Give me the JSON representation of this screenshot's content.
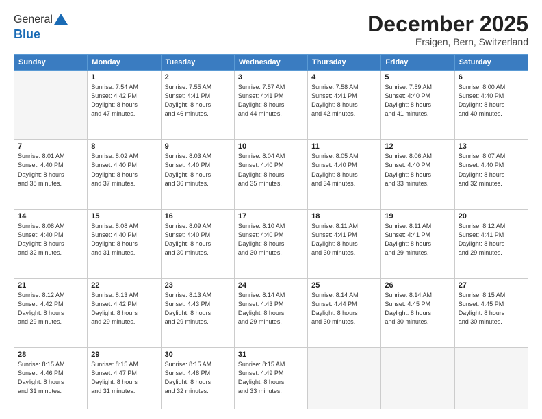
{
  "logo": {
    "general": "General",
    "blue": "Blue"
  },
  "header": {
    "month": "December 2025",
    "location": "Ersigen, Bern, Switzerland"
  },
  "weekdays": [
    "Sunday",
    "Monday",
    "Tuesday",
    "Wednesday",
    "Thursday",
    "Friday",
    "Saturday"
  ],
  "weeks": [
    [
      {
        "day": "",
        "info": ""
      },
      {
        "day": "1",
        "info": "Sunrise: 7:54 AM\nSunset: 4:42 PM\nDaylight: 8 hours\nand 47 minutes."
      },
      {
        "day": "2",
        "info": "Sunrise: 7:55 AM\nSunset: 4:41 PM\nDaylight: 8 hours\nand 46 minutes."
      },
      {
        "day": "3",
        "info": "Sunrise: 7:57 AM\nSunset: 4:41 PM\nDaylight: 8 hours\nand 44 minutes."
      },
      {
        "day": "4",
        "info": "Sunrise: 7:58 AM\nSunset: 4:41 PM\nDaylight: 8 hours\nand 42 minutes."
      },
      {
        "day": "5",
        "info": "Sunrise: 7:59 AM\nSunset: 4:40 PM\nDaylight: 8 hours\nand 41 minutes."
      },
      {
        "day": "6",
        "info": "Sunrise: 8:00 AM\nSunset: 4:40 PM\nDaylight: 8 hours\nand 40 minutes."
      }
    ],
    [
      {
        "day": "7",
        "info": "Sunrise: 8:01 AM\nSunset: 4:40 PM\nDaylight: 8 hours\nand 38 minutes."
      },
      {
        "day": "8",
        "info": "Sunrise: 8:02 AM\nSunset: 4:40 PM\nDaylight: 8 hours\nand 37 minutes."
      },
      {
        "day": "9",
        "info": "Sunrise: 8:03 AM\nSunset: 4:40 PM\nDaylight: 8 hours\nand 36 minutes."
      },
      {
        "day": "10",
        "info": "Sunrise: 8:04 AM\nSunset: 4:40 PM\nDaylight: 8 hours\nand 35 minutes."
      },
      {
        "day": "11",
        "info": "Sunrise: 8:05 AM\nSunset: 4:40 PM\nDaylight: 8 hours\nand 34 minutes."
      },
      {
        "day": "12",
        "info": "Sunrise: 8:06 AM\nSunset: 4:40 PM\nDaylight: 8 hours\nand 33 minutes."
      },
      {
        "day": "13",
        "info": "Sunrise: 8:07 AM\nSunset: 4:40 PM\nDaylight: 8 hours\nand 32 minutes."
      }
    ],
    [
      {
        "day": "14",
        "info": "Sunrise: 8:08 AM\nSunset: 4:40 PM\nDaylight: 8 hours\nand 32 minutes."
      },
      {
        "day": "15",
        "info": "Sunrise: 8:08 AM\nSunset: 4:40 PM\nDaylight: 8 hours\nand 31 minutes."
      },
      {
        "day": "16",
        "info": "Sunrise: 8:09 AM\nSunset: 4:40 PM\nDaylight: 8 hours\nand 30 minutes."
      },
      {
        "day": "17",
        "info": "Sunrise: 8:10 AM\nSunset: 4:40 PM\nDaylight: 8 hours\nand 30 minutes."
      },
      {
        "day": "18",
        "info": "Sunrise: 8:11 AM\nSunset: 4:41 PM\nDaylight: 8 hours\nand 30 minutes."
      },
      {
        "day": "19",
        "info": "Sunrise: 8:11 AM\nSunset: 4:41 PM\nDaylight: 8 hours\nand 29 minutes."
      },
      {
        "day": "20",
        "info": "Sunrise: 8:12 AM\nSunset: 4:41 PM\nDaylight: 8 hours\nand 29 minutes."
      }
    ],
    [
      {
        "day": "21",
        "info": "Sunrise: 8:12 AM\nSunset: 4:42 PM\nDaylight: 8 hours\nand 29 minutes."
      },
      {
        "day": "22",
        "info": "Sunrise: 8:13 AM\nSunset: 4:42 PM\nDaylight: 8 hours\nand 29 minutes."
      },
      {
        "day": "23",
        "info": "Sunrise: 8:13 AM\nSunset: 4:43 PM\nDaylight: 8 hours\nand 29 minutes."
      },
      {
        "day": "24",
        "info": "Sunrise: 8:14 AM\nSunset: 4:43 PM\nDaylight: 8 hours\nand 29 minutes."
      },
      {
        "day": "25",
        "info": "Sunrise: 8:14 AM\nSunset: 4:44 PM\nDaylight: 8 hours\nand 30 minutes."
      },
      {
        "day": "26",
        "info": "Sunrise: 8:14 AM\nSunset: 4:45 PM\nDaylight: 8 hours\nand 30 minutes."
      },
      {
        "day": "27",
        "info": "Sunrise: 8:15 AM\nSunset: 4:45 PM\nDaylight: 8 hours\nand 30 minutes."
      }
    ],
    [
      {
        "day": "28",
        "info": "Sunrise: 8:15 AM\nSunset: 4:46 PM\nDaylight: 8 hours\nand 31 minutes."
      },
      {
        "day": "29",
        "info": "Sunrise: 8:15 AM\nSunset: 4:47 PM\nDaylight: 8 hours\nand 31 minutes."
      },
      {
        "day": "30",
        "info": "Sunrise: 8:15 AM\nSunset: 4:48 PM\nDaylight: 8 hours\nand 32 minutes."
      },
      {
        "day": "31",
        "info": "Sunrise: 8:15 AM\nSunset: 4:49 PM\nDaylight: 8 hours\nand 33 minutes."
      },
      {
        "day": "",
        "info": ""
      },
      {
        "day": "",
        "info": ""
      },
      {
        "day": "",
        "info": ""
      }
    ]
  ]
}
